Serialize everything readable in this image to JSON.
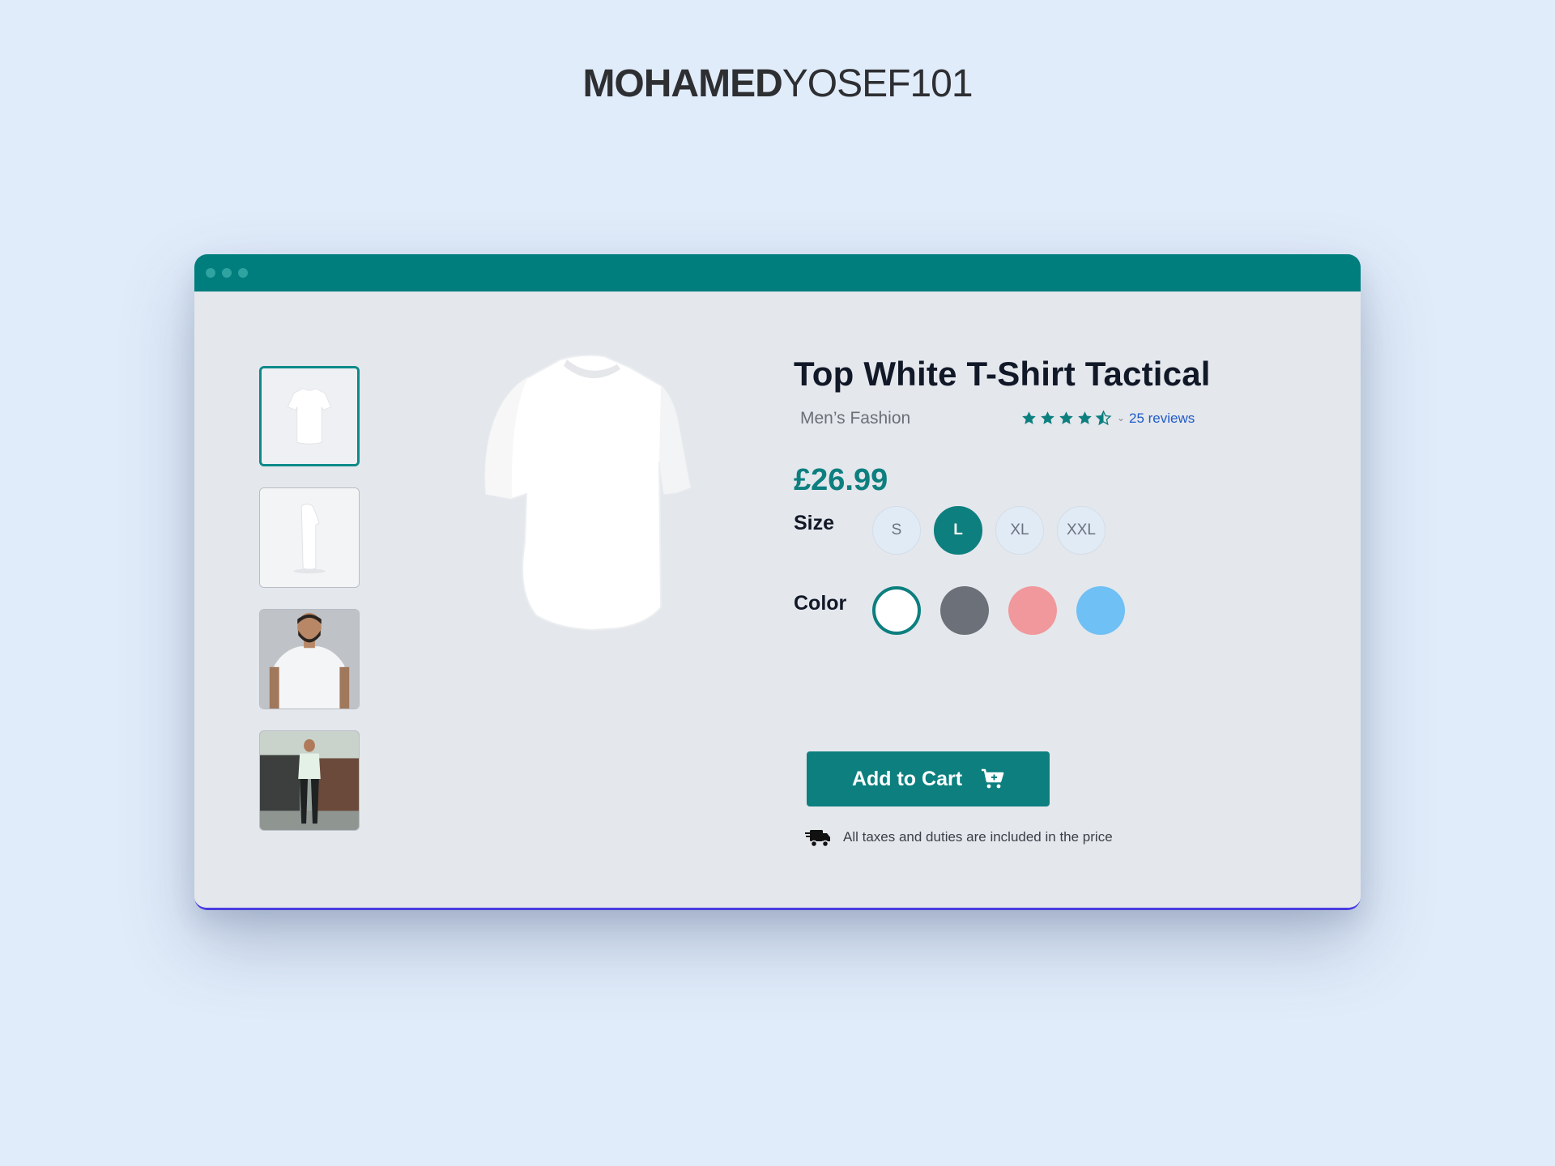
{
  "brand": {
    "bold": "MOHAMED",
    "light": "YOSEF101"
  },
  "window": {
    "accent_color": "#007d7d",
    "controls": [
      "window-dot",
      "window-dot",
      "window-dot"
    ]
  },
  "gallery": {
    "thumbnails": [
      {
        "name": "tshirt-front",
        "selected": true
      },
      {
        "name": "tshirt-side",
        "selected": false
      },
      {
        "name": "model-closeup",
        "selected": false
      },
      {
        "name": "model-street",
        "selected": false
      }
    ],
    "main_image": "tshirt-front"
  },
  "product": {
    "title": "Top White T-Shirt Tactical",
    "category": "Men’s Fashion",
    "rating": 4.5,
    "rating_max": 5,
    "reviews_label": "25 reviews",
    "price": "£26.99"
  },
  "options": {
    "size_label": "Size",
    "sizes": [
      "S",
      "L",
      "XL",
      "XXL"
    ],
    "selected_size": "L",
    "color_label": "Color",
    "colors": [
      "#ffffff",
      "#6b7079",
      "#f0989b",
      "#6ec0f5"
    ],
    "selected_color": "#ffffff"
  },
  "cart": {
    "button_label": "Add to Cart",
    "icon": "cart-plus-icon",
    "shipping_icon": "fast-truck-icon",
    "note": "All taxes and duties are included in the price"
  }
}
